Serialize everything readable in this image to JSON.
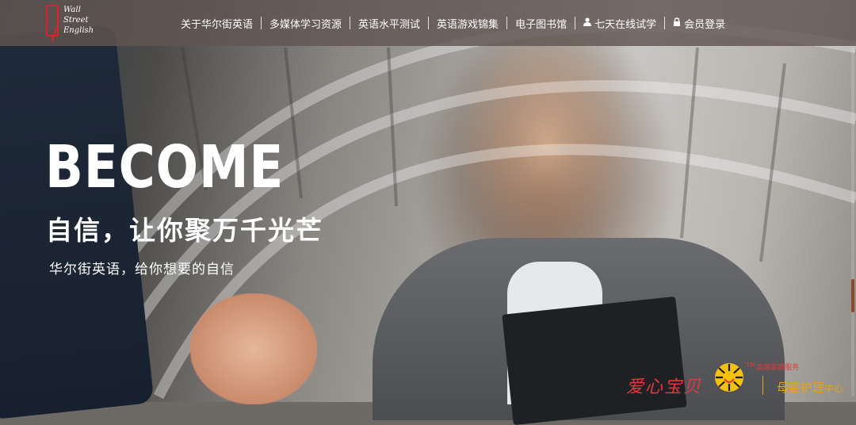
{
  "logo": {
    "line1": "Wall",
    "line2": "Street",
    "line3": "English"
  },
  "nav": {
    "items": [
      {
        "label": "关于华尔街英语",
        "icon": ""
      },
      {
        "label": "多媒体学习资源",
        "icon": ""
      },
      {
        "label": "英语水平测试",
        "icon": ""
      },
      {
        "label": "英语游戏锦集",
        "icon": ""
      },
      {
        "label": "电子图书馆",
        "icon": ""
      },
      {
        "label": "七天在线试学",
        "icon": "user-icon"
      },
      {
        "label": "会员登录",
        "icon": "lock-icon"
      }
    ]
  },
  "hero": {
    "headline": "BECOME",
    "tagline": "自信，让你聚万千光芒",
    "subline": "华尔街英语，给你想要的自信"
  },
  "watermark": {
    "brand": "爱心宝贝",
    "tm": "TM",
    "service": "高端家庭服务",
    "care": "母婴护理",
    "care_suffix": "中心"
  },
  "colors": {
    "nav_bg": "#605650",
    "logo_red": "#e0202a",
    "watermark_red": "#e23a3a",
    "watermark_gold": "#e8a31a"
  }
}
